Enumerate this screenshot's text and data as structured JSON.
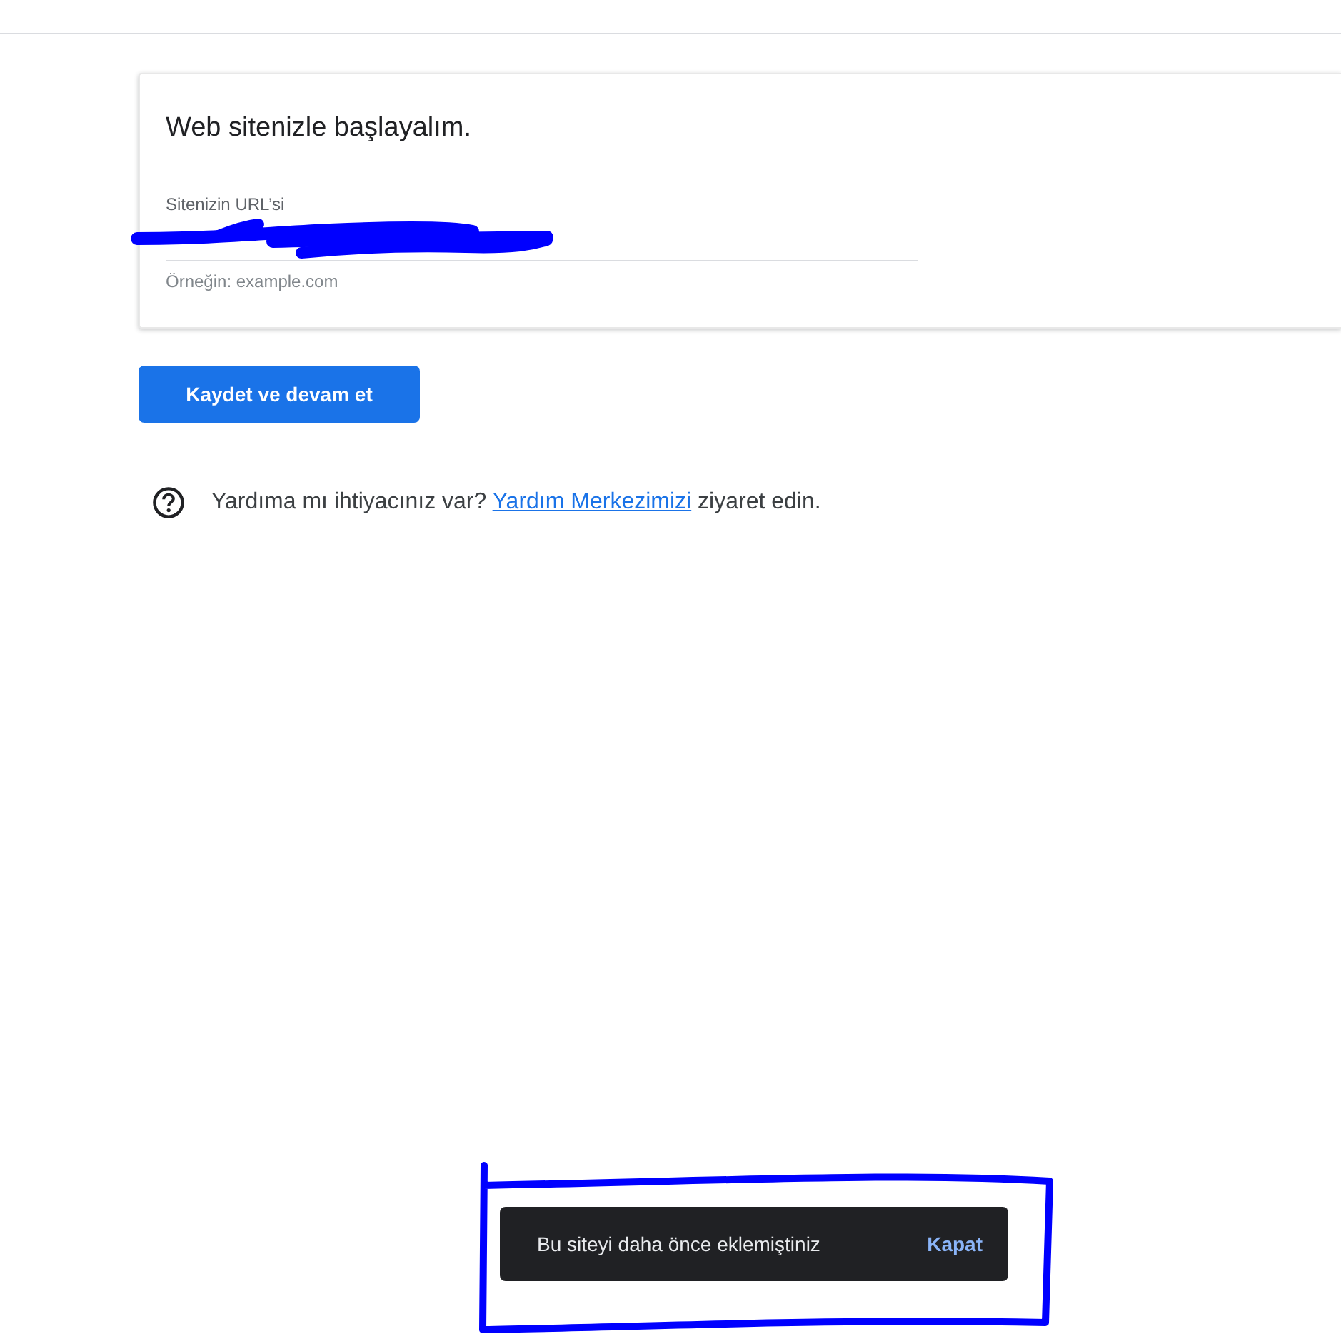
{
  "setup_card": {
    "title": "Web sitenizle başlayalım.",
    "url_field": {
      "label": "Sitenizin URL’si",
      "hint": "Örneğin: example.com",
      "scribbled_over": true
    }
  },
  "save_button": "Kaydet ve devam et",
  "help": {
    "text_before": "Yardıma mı ihtiyacınız var?",
    "link": "Yardım Merkezimizi",
    "text_after": "ziyaret edin."
  },
  "snackbar": {
    "message": "Bu siteyi daha önce eklemiştiniz",
    "action": "Kapat",
    "framed": true
  }
}
